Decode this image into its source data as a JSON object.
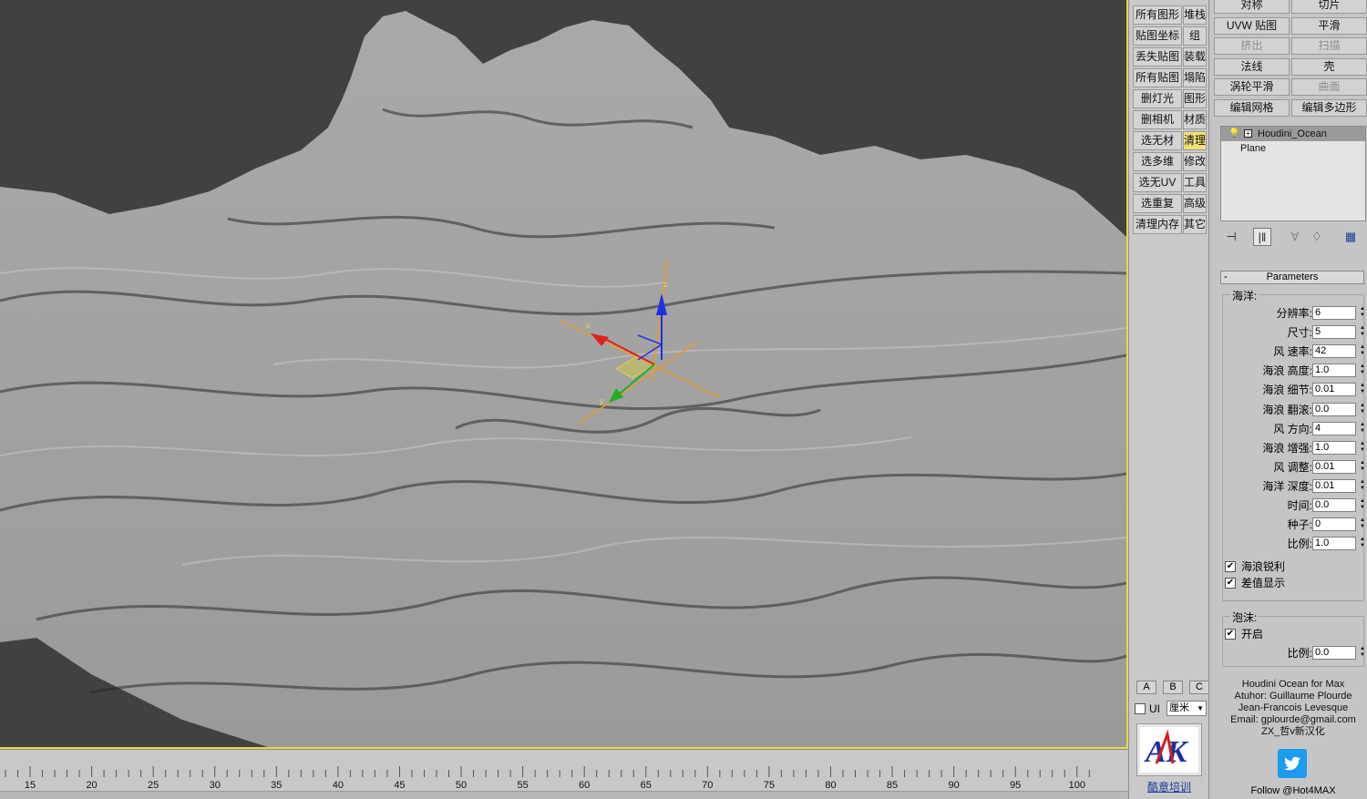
{
  "viewport": {
    "axis_x_label": "x",
    "axis_y_label": "y",
    "axis_z_label": "z"
  },
  "timeline": {
    "ticks": [
      "15",
      "20",
      "25",
      "30",
      "35",
      "40",
      "45",
      "50",
      "55",
      "60",
      "65",
      "70",
      "75",
      "80",
      "85",
      "90",
      "95",
      "100"
    ]
  },
  "toolbar": {
    "rows": [
      {
        "left": "所有图形",
        "right": "堆栈",
        "right_active": false
      },
      {
        "left": "贴图坐标",
        "right": "组",
        "right_active": false
      },
      {
        "left": "丢失贴图",
        "right": "装载",
        "right_active": false
      },
      {
        "left": "所有贴图",
        "right": "塌陷",
        "right_active": false
      },
      {
        "left": "删灯光",
        "right": "图形",
        "right_active": false
      },
      {
        "left": "删相机",
        "right": "材质",
        "right_active": false
      },
      {
        "left": "选无材",
        "right": "清理",
        "right_active": true
      },
      {
        "left": "选多维",
        "right": "修改",
        "right_active": false
      },
      {
        "left": "选无UV",
        "right": "工具",
        "right_active": false
      },
      {
        "left": "选重复",
        "right": "高级",
        "right_active": false
      },
      {
        "left": "清理内存",
        "right": "其它",
        "right_active": false
      }
    ],
    "abc": [
      "A",
      "B",
      "C"
    ],
    "ui_label": "UI",
    "unit_value": "厘米",
    "logo_text": "AK",
    "logo_caption": "酷意培训"
  },
  "modifiers": {
    "buttons": [
      {
        "label": "对称",
        "disabled": false
      },
      {
        "label": "切片",
        "disabled": false
      },
      {
        "label": "UVW 贴图",
        "disabled": false
      },
      {
        "label": "平滑",
        "disabled": false
      },
      {
        "label": "挤出",
        "disabled": true
      },
      {
        "label": "扫描",
        "disabled": true
      },
      {
        "label": "法线",
        "disabled": false
      },
      {
        "label": "壳",
        "disabled": false
      },
      {
        "label": "涡轮平滑",
        "disabled": false
      },
      {
        "label": "曲面",
        "disabled": true
      },
      {
        "label": "编辑网格",
        "disabled": false
      },
      {
        "label": "编辑多边形",
        "disabled": false
      }
    ]
  },
  "stack": {
    "selected": "Houdini_Ocean",
    "base": "Plane"
  },
  "parameters": {
    "rollout_title": "Parameters",
    "rollout_toggle": "-",
    "ocean_group": "海洋:",
    "fields": [
      {
        "label": "分辨率:",
        "value": "6"
      },
      {
        "label": "尺寸:",
        "value": "5"
      },
      {
        "label": "风 速率:",
        "value": "42"
      },
      {
        "label": "海浪 高度:",
        "value": "1.0"
      },
      {
        "label": "海浪 细节:",
        "value": "0.01"
      },
      {
        "label": "海浪 翻滚:",
        "value": "0.0"
      },
      {
        "label": "风 方向:",
        "value": "4"
      },
      {
        "label": "海浪 增强:",
        "value": "1.0"
      },
      {
        "label": "风 调整:",
        "value": "0.01"
      },
      {
        "label": "海洋 深度:",
        "value": "0.01"
      },
      {
        "label": "时间:",
        "value": "0.0"
      },
      {
        "label": "种子:",
        "value": "0"
      },
      {
        "label": "比例:",
        "value": "1.0"
      }
    ],
    "check_sharp": "海浪锐利",
    "check_interp": "差值显示",
    "foam_group": "泡沫:",
    "foam_enable": "开启",
    "foam_scale_label": "比例:",
    "foam_scale_value": "0.0"
  },
  "credits": {
    "lines": [
      "Houdini Ocean for Max",
      "Atuhor: Guillaume Plourde",
      "Jean-Francois Levesque",
      "Email: gplourde@gmail.com",
      "ZX_哲v新汉化"
    ],
    "follow": "Follow @Hot4MAX"
  }
}
